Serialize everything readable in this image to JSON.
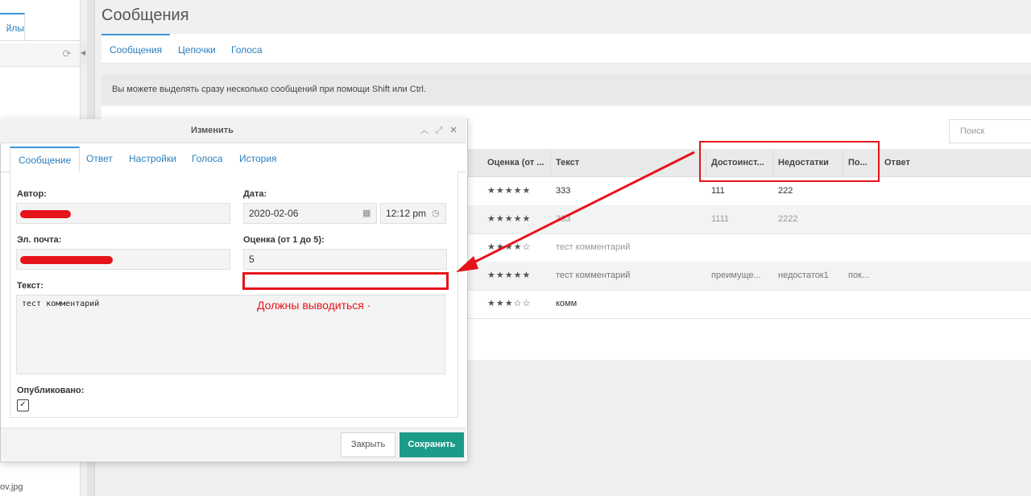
{
  "left_panel": {
    "tab_label": "йлы",
    "file_name": "ov.jpg"
  },
  "main": {
    "title": "Сообщения",
    "tabs": [
      "Сообщения",
      "Цепочки",
      "Голоса"
    ],
    "info": "Вы можете выделять сразу несколько сообщений при помощи Shift или Ctrl.",
    "search_placeholder": "Поиск"
  },
  "grid": {
    "columns": [
      "Оценка (от ...",
      "Текст",
      "Достоинст...",
      "Недостатки",
      "По...",
      "Ответ"
    ],
    "rows": [
      {
        "rating": "★★★★★",
        "text": "333",
        "pros": "111",
        "cons": "222",
        "comment": "",
        "answer": ""
      },
      {
        "rating": "★★★★★",
        "text": "333",
        "pros": "1111",
        "cons": "2222",
        "comment": "",
        "answer": ""
      },
      {
        "rating": "★★★★☆",
        "text": "тест комментарий",
        "pros": "",
        "cons": "",
        "comment": "",
        "answer": ""
      },
      {
        "rating": "★★★★★",
        "text": "тест комментарий",
        "pros": "преимуще...",
        "cons": "недостаток1",
        "comment": "пок...",
        "answer": ""
      },
      {
        "rating": "★★★☆☆",
        "text": "комм",
        "pros": "",
        "cons": "",
        "comment": "",
        "answer": ""
      }
    ]
  },
  "dialog": {
    "title": "Изменить",
    "tabs": [
      "Сообщение",
      "Ответ",
      "Настройки",
      "Голоса",
      "История"
    ],
    "author_label": "Автор:",
    "date_label": "Дата:",
    "date_value": "2020-02-06",
    "time_value": "12:12 pm",
    "email_label": "Эл. почта:",
    "rating_label": "Оценка (от 1 до 5):",
    "rating_value": "5",
    "text_label": "Текст:",
    "text_value": "тест комментарий",
    "published_label": "Опубликовано:",
    "close_button": "Закрыть",
    "save_button": "Сохранить"
  },
  "annotation": {
    "note": "Должны выводиться ·",
    "color": "#e5141b"
  },
  "colors": {
    "accent_blue": "#3d95d3",
    "save_green": "#1c9b88"
  }
}
